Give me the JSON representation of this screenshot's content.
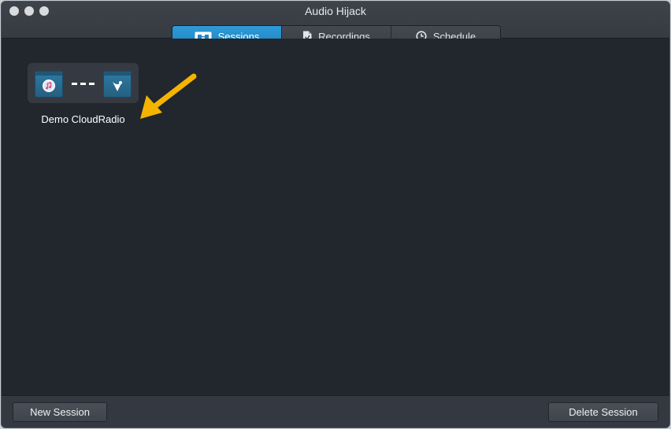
{
  "window": {
    "title": "Audio Hijack"
  },
  "tabs": [
    {
      "label": "Sessions",
      "icon": "sessions-icon",
      "active": true
    },
    {
      "label": "Recordings",
      "icon": "recordings-icon",
      "active": false
    },
    {
      "label": "Schedule",
      "icon": "clock-icon",
      "active": false
    }
  ],
  "sessions": [
    {
      "name": "Demo CloudRadio",
      "source_icon": "music-app-icon",
      "output_icon": "broadcast-icon"
    }
  ],
  "footer": {
    "new_session_label": "New Session",
    "delete_session_label": "Delete Session"
  },
  "colors": {
    "active_tab": "#2090cc",
    "annotation_arrow": "#f5b400",
    "background": "#22262d"
  }
}
